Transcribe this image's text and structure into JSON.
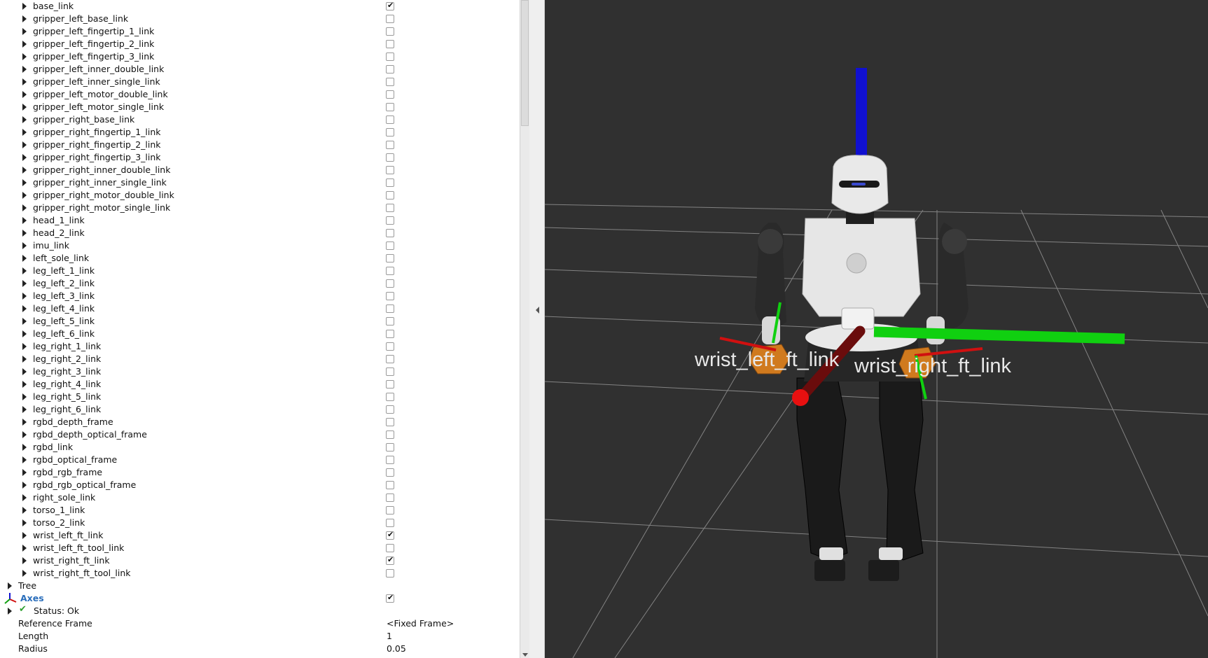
{
  "displays_tree": {
    "frame_links": [
      {
        "label": "base_link",
        "checked": true
      },
      {
        "label": "gripper_left_base_link",
        "checked": false
      },
      {
        "label": "gripper_left_fingertip_1_link",
        "checked": false
      },
      {
        "label": "gripper_left_fingertip_2_link",
        "checked": false
      },
      {
        "label": "gripper_left_fingertip_3_link",
        "checked": false
      },
      {
        "label": "gripper_left_inner_double_link",
        "checked": false
      },
      {
        "label": "gripper_left_inner_single_link",
        "checked": false
      },
      {
        "label": "gripper_left_motor_double_link",
        "checked": false
      },
      {
        "label": "gripper_left_motor_single_link",
        "checked": false
      },
      {
        "label": "gripper_right_base_link",
        "checked": false
      },
      {
        "label": "gripper_right_fingertip_1_link",
        "checked": false
      },
      {
        "label": "gripper_right_fingertip_2_link",
        "checked": false
      },
      {
        "label": "gripper_right_fingertip_3_link",
        "checked": false
      },
      {
        "label": "gripper_right_inner_double_link",
        "checked": false
      },
      {
        "label": "gripper_right_inner_single_link",
        "checked": false
      },
      {
        "label": "gripper_right_motor_double_link",
        "checked": false
      },
      {
        "label": "gripper_right_motor_single_link",
        "checked": false
      },
      {
        "label": "head_1_link",
        "checked": false
      },
      {
        "label": "head_2_link",
        "checked": false
      },
      {
        "label": "imu_link",
        "checked": false
      },
      {
        "label": "left_sole_link",
        "checked": false
      },
      {
        "label": "leg_left_1_link",
        "checked": false
      },
      {
        "label": "leg_left_2_link",
        "checked": false
      },
      {
        "label": "leg_left_3_link",
        "checked": false
      },
      {
        "label": "leg_left_4_link",
        "checked": false
      },
      {
        "label": "leg_left_5_link",
        "checked": false
      },
      {
        "label": "leg_left_6_link",
        "checked": false
      },
      {
        "label": "leg_right_1_link",
        "checked": false
      },
      {
        "label": "leg_right_2_link",
        "checked": false
      },
      {
        "label": "leg_right_3_link",
        "checked": false
      },
      {
        "label": "leg_right_4_link",
        "checked": false
      },
      {
        "label": "leg_right_5_link",
        "checked": false
      },
      {
        "label": "leg_right_6_link",
        "checked": false
      },
      {
        "label": "rgbd_depth_frame",
        "checked": false
      },
      {
        "label": "rgbd_depth_optical_frame",
        "checked": false
      },
      {
        "label": "rgbd_link",
        "checked": false
      },
      {
        "label": "rgbd_optical_frame",
        "checked": false
      },
      {
        "label": "rgbd_rgb_frame",
        "checked": false
      },
      {
        "label": "rgbd_rgb_optical_frame",
        "checked": false
      },
      {
        "label": "right_sole_link",
        "checked": false
      },
      {
        "label": "torso_1_link",
        "checked": false
      },
      {
        "label": "torso_2_link",
        "checked": false
      },
      {
        "label": "wrist_left_ft_link",
        "checked": true
      },
      {
        "label": "wrist_left_ft_tool_link",
        "checked": false
      },
      {
        "label": "wrist_right_ft_link",
        "checked": true
      },
      {
        "label": "wrist_right_ft_tool_link",
        "checked": false
      }
    ],
    "tree_label": "Tree",
    "axes": {
      "label": "Axes",
      "enabled": true,
      "status": "Status: Ok",
      "properties": [
        {
          "name": "Reference Frame",
          "value": "<Fixed Frame>"
        },
        {
          "name": "Length",
          "value": "1"
        },
        {
          "name": "Radius",
          "value": "0.05"
        }
      ]
    }
  },
  "viewport": {
    "frame_labels": [
      "wrist_left_ft_link",
      "wrist_right_ft_link"
    ],
    "background_color": "#303030",
    "grid_color": "#8c8c8c",
    "axis_colors": {
      "x": "#d01010",
      "y": "#10d010",
      "z": "#1010d0"
    }
  }
}
